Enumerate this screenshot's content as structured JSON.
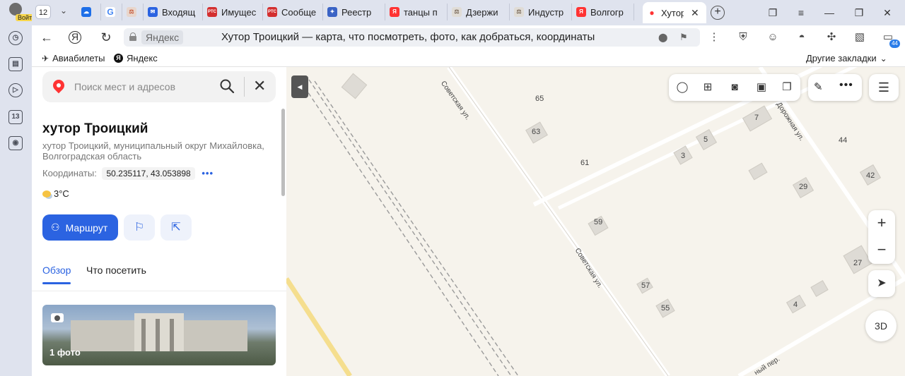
{
  "rail": {
    "login_label": "Войти",
    "badge_13": "13"
  },
  "tabs": {
    "counter": "12",
    "items": [
      {
        "label": "",
        "icon": "cloud-icon",
        "color": "#1e6fe8"
      },
      {
        "label": "",
        "icon": "google-icon",
        "color": "#4285f4"
      },
      {
        "label": "",
        "icon": "scales-icon",
        "color": "#c65a3a"
      },
      {
        "label": "Входящ",
        "icon": "mail-icon",
        "color": "#2b63e1"
      },
      {
        "label": "Имущес",
        "icon": "rts-icon",
        "color": "#d32f2f"
      },
      {
        "label": "Сообще",
        "icon": "rts-icon",
        "color": "#d32f2f"
      },
      {
        "label": "Реестр",
        "icon": "eagle-icon",
        "color": "#3a63c5"
      },
      {
        "label": "танцы п",
        "icon": "yandex-icon",
        "color": "#f33"
      },
      {
        "label": "Дзержи",
        "icon": "scales-icon",
        "color": "#7a6a5a"
      },
      {
        "label": "Индустр",
        "icon": "scales-icon",
        "color": "#7a6a5a"
      },
      {
        "label": "Волгогр",
        "icon": "yandex-icon",
        "color": "#f33"
      },
      {
        "label": "Хутор",
        "icon": "maps-pin-icon",
        "color": "#f33",
        "active": true
      }
    ]
  },
  "address": {
    "site": "Яндекс",
    "title": "Хутор Троицкий — карта, что посмотреть, фото, как добраться, координаты",
    "ext_badge": "44"
  },
  "bookmarks": {
    "items": [
      {
        "label": "Авиабилеты",
        "icon": "plane-icon"
      },
      {
        "label": "Яндекс",
        "icon": "yandex-icon"
      }
    ],
    "other": "Другие закладки"
  },
  "panel": {
    "search_placeholder": "Поиск мест и адресов",
    "title": "хутор Троицкий",
    "subtitle": "хутор Троицкий, муниципальный округ Михайловка, Волгоградская область",
    "coords_label": "Координаты:",
    "coords_value": "50.235117, 43.053898",
    "weather": "3°C",
    "route_label": "Маршрут",
    "tab_overview": "Обзор",
    "tab_visit": "Что посетить",
    "photo_count": "1 фото"
  },
  "map": {
    "labels": {
      "n65": "65",
      "n63": "63",
      "n61": "61",
      "n59": "59",
      "n57": "57",
      "n55": "55",
      "n7": "7",
      "n5": "5",
      "n3": "3",
      "n29": "29",
      "n27": "27",
      "n4": "4",
      "n44": "44",
      "n42": "42"
    },
    "streets": {
      "sovetskaya_top": "Советская ул.",
      "sovetskaya_mid": "Советская ул.",
      "dorozhnaya": "Дорожная ул.",
      "per": "ный пер."
    },
    "btn_3d": "3D"
  }
}
